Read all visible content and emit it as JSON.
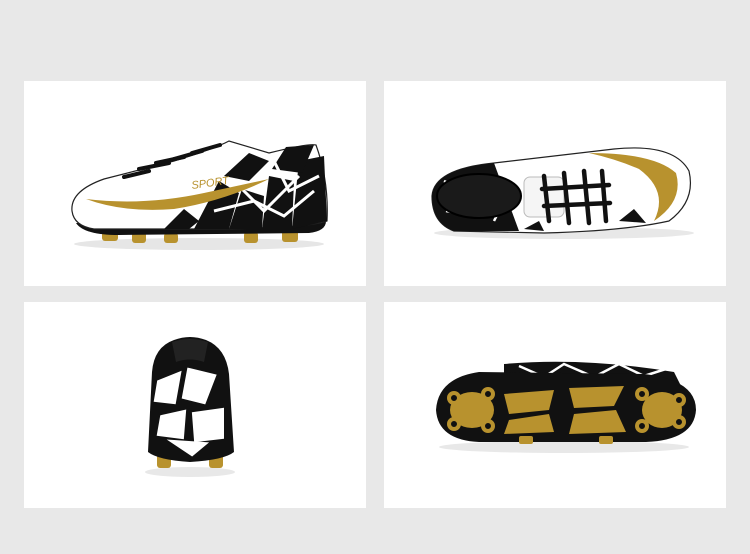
{
  "gallery": {
    "background": "#e8e8e8",
    "panels": [
      {
        "view": "side",
        "brand_text": "SPORT"
      },
      {
        "view": "top"
      },
      {
        "view": "back"
      },
      {
        "view": "sole"
      }
    ]
  },
  "colors": {
    "black": "#111111",
    "white": "#ffffff",
    "gold": "#b8922e",
    "panel": "#ffffff"
  }
}
